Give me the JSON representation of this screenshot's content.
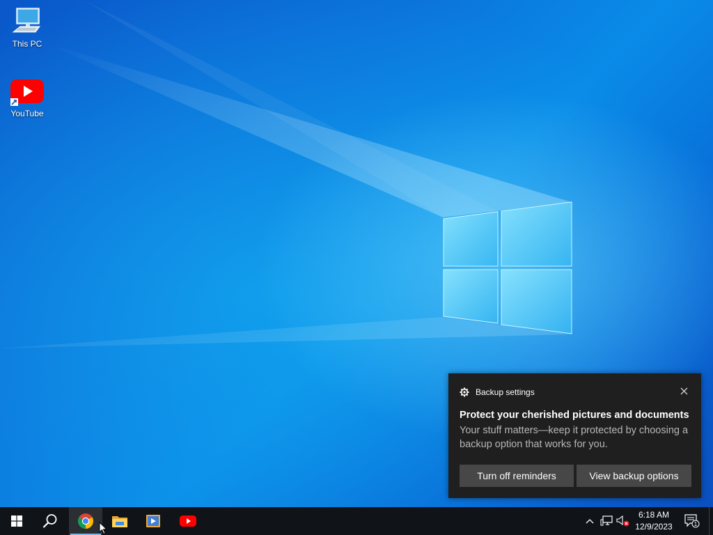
{
  "desktop": {
    "icons": [
      {
        "label": "This PC",
        "icon": "computer-icon"
      },
      {
        "label": "YouTube",
        "icon": "youtube-icon"
      }
    ]
  },
  "toast": {
    "app_name": "Backup settings",
    "app_icon": "gear-icon",
    "title": "Protect your cherished pictures and documents",
    "body": "Your stuff matters—keep it protected by choosing a backup option that works for you.",
    "buttons": {
      "turn_off": "Turn off reminders",
      "view_options": "View backup options"
    }
  },
  "taskbar": {
    "apps": [
      {
        "name": "start",
        "icon": "windows-logo-icon"
      },
      {
        "name": "search",
        "icon": "search-icon"
      },
      {
        "name": "chrome",
        "icon": "chrome-icon"
      },
      {
        "name": "file-explorer",
        "icon": "folder-icon"
      },
      {
        "name": "media-player",
        "icon": "media-player-icon"
      },
      {
        "name": "youtube",
        "icon": "youtube-icon"
      }
    ],
    "clock": {
      "time": "6:18 AM",
      "date": "12/9/2023"
    },
    "notification_count": "1"
  },
  "colors": {
    "taskbar_bg": "#101418",
    "toast_bg": "#1f1f1f",
    "toast_button_bg": "#474747",
    "accent": "#76b9ed",
    "youtube_red": "#ff0000"
  }
}
